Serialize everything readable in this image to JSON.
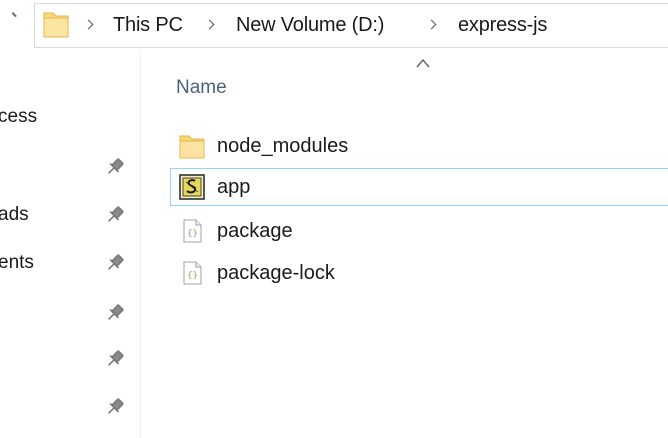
{
  "address_bar": {
    "breadcrumbs": [
      "This PC",
      "New Volume (D:)",
      "express-js"
    ]
  },
  "nav_pane": {
    "items": [
      {
        "label": "cess",
        "pinned": false,
        "color": "#1a1a1a"
      },
      {
        "label": "",
        "pinned": true,
        "color": "#1e6fd0"
      },
      {
        "label": "ads",
        "pinned": true,
        "color": "#1a1a1a"
      },
      {
        "label": "ents",
        "pinned": true,
        "color": "#1a1a1a"
      },
      {
        "label": "",
        "pinned": true,
        "color": "#1a1a1a"
      },
      {
        "label": "",
        "pinned": true,
        "color": "#1a1a1a"
      },
      {
        "label": "",
        "pinned": true,
        "color": "#1a1a1a"
      }
    ]
  },
  "file_list": {
    "column_header": "Name",
    "sort": "ascending",
    "files": [
      {
        "name": "node_modules",
        "icon": "folder-icon",
        "selected": false
      },
      {
        "name": "app",
        "icon": "script-file-icon",
        "selected": true
      },
      {
        "name": "package",
        "icon": "json-file-icon",
        "selected": false
      },
      {
        "name": "package-lock",
        "icon": "json-file-icon",
        "selected": false
      }
    ]
  },
  "colors": {
    "folder_yellow": "#f8d775",
    "selection_border": "#99d1ff",
    "header_text": "#4a6282",
    "nav_blue": "#1e6fd0"
  }
}
